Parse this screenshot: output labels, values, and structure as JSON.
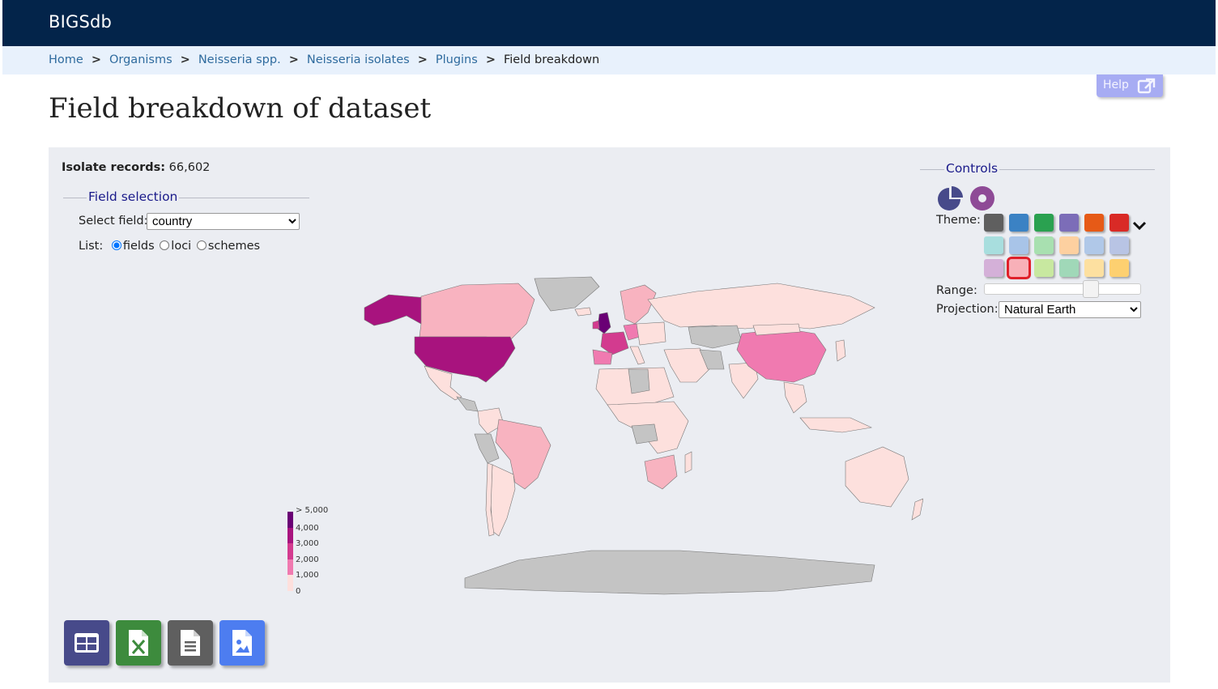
{
  "header": {
    "brand": "BIGSdb"
  },
  "breadcrumb": {
    "items": [
      "Home",
      "Organisms",
      "Neisseria spp.",
      "Neisseria isolates",
      "Plugins"
    ],
    "current": "Field breakdown",
    "separator": ">"
  },
  "help": {
    "label": "Help"
  },
  "page": {
    "title": "Field breakdown of dataset"
  },
  "records": {
    "label": "Isolate records:",
    "value": "66,602"
  },
  "field_selection": {
    "legend": "Field selection",
    "select_label": "Select field:",
    "select_value": "country",
    "list_label": "List:",
    "list_options": [
      "fields",
      "loci",
      "schemes"
    ],
    "list_selected": "fields"
  },
  "controls": {
    "legend": "Controls",
    "theme_label": "Theme:",
    "range_label": "Range:",
    "range_value": 0.7,
    "projection_label": "Projection:",
    "projection_value": "Natural Earth",
    "themes": [
      "#5f5f5f",
      "#3b82c4",
      "#2aa150",
      "#7c6db8",
      "#e65a17",
      "#d92a26",
      "#a8dede",
      "#a8c4e8",
      "#a8e0b0",
      "#fdd0a0",
      "#b0c8e8",
      "#b8c4e4",
      "#d4b0d8",
      "#f8b0b8",
      "#c8e8a0",
      "#a0d8b8",
      "#fde0a0",
      "#fdd070"
    ],
    "selected_theme_index": 13
  },
  "map_legend": {
    "labels": [
      "> 5,000",
      "4,000",
      "3,000",
      "2,000",
      "1,000",
      "0"
    ],
    "colors": [
      "#6a0075",
      "#a8137e",
      "#d33b8f",
      "#f07ab0",
      "#f8b3c0",
      "#fde0dd"
    ]
  },
  "exports": [
    {
      "name": "table-export-button",
      "icon": "table-icon",
      "color": "#474a8a"
    },
    {
      "name": "excel-export-button",
      "icon": "excel-icon",
      "color": "#3d8b3d"
    },
    {
      "name": "text-export-button",
      "icon": "text-file-icon",
      "color": "#5f5f5f"
    },
    {
      "name": "image-export-button",
      "icon": "image-file-icon",
      "color": "#4d7df0"
    }
  ]
}
